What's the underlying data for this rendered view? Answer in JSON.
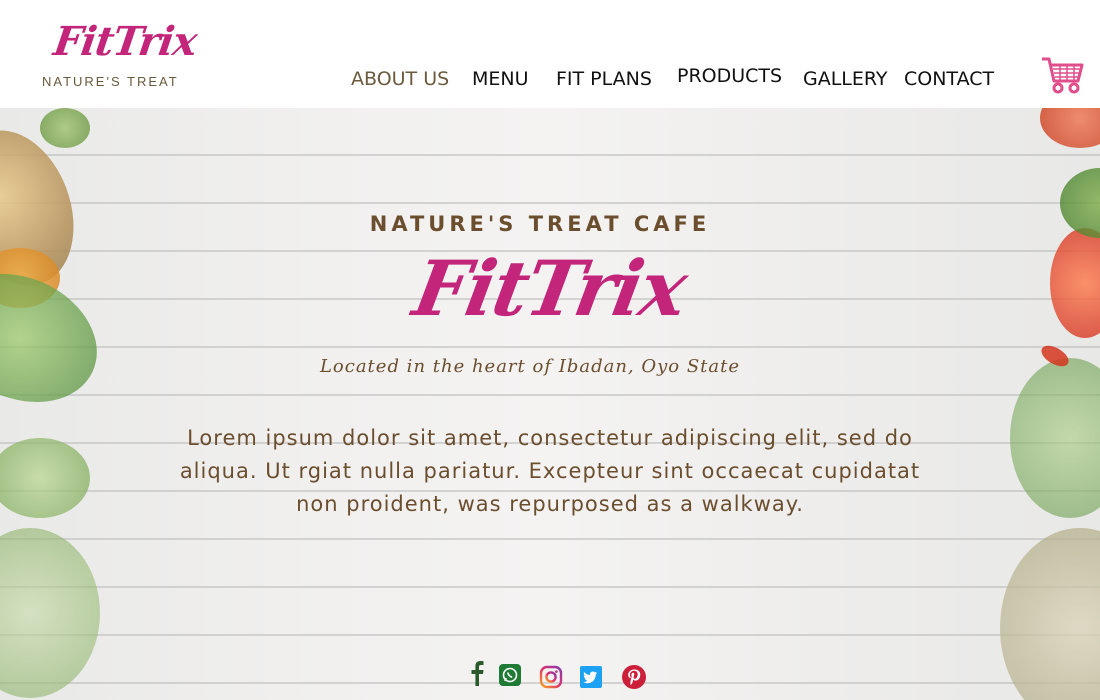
{
  "brand": {
    "logo_text": "FitTrix",
    "logo_subtitle": "NATURE'S TREAT",
    "accent_color": "#c2257a",
    "brown_color": "#6b4e2e"
  },
  "nav": {
    "items": [
      {
        "label": "ABOUT US",
        "active": true
      },
      {
        "label": "MENU",
        "active": false
      },
      {
        "label": "FIT PLANS",
        "active": false
      },
      {
        "label": "PRODUCTS",
        "active": false
      },
      {
        "label": "GALLERY",
        "active": false
      },
      {
        "label": "CONTACT",
        "active": false
      }
    ],
    "cart_icon": "shopping-cart-icon"
  },
  "hero": {
    "eyebrow": "NATURE'S TREAT CAFE",
    "title": "FitTrix",
    "tagline": "Located in the heart of Ibadan, Oyo State",
    "description": "Lorem ipsum dolor sit amet, consectetur adipiscing elit, sed do aliqua. Ut  rgiat nulla pariatur. Excepteur sint occaecat cupidatat non proident, was repurposed as a walkway."
  },
  "social": {
    "icons": [
      "facebook-icon",
      "whatsapp-icon",
      "instagram-icon",
      "twitter-icon",
      "pinterest-icon"
    ]
  }
}
